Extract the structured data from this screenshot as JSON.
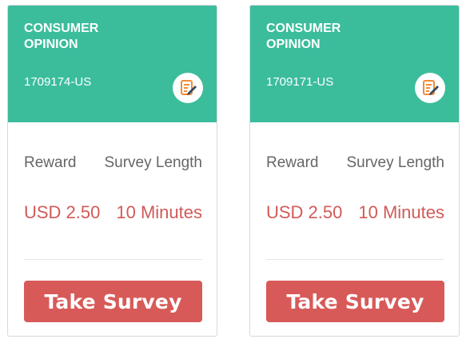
{
  "cards": [
    {
      "title": "CONSUMER\nOPINION",
      "survey_id": "1709174-US",
      "labels": {
        "reward": "Reward",
        "length": "Survey Length"
      },
      "values": {
        "reward": "USD 2.50",
        "length": "10 Minutes"
      },
      "button_label": "Take Survey"
    },
    {
      "title": "CONSUMER\nOPINION",
      "survey_id": "1709171-US",
      "labels": {
        "reward": "Reward",
        "length": "Survey Length"
      },
      "values": {
        "reward": "USD 2.50",
        "length": "10 Minutes"
      },
      "button_label": "Take Survey"
    }
  ],
  "icons": {
    "badge": "survey-edit-icon"
  },
  "colors": {
    "header": "#3bbd9c",
    "value_text": "#d15a58",
    "button": "#d75a59",
    "icon_accent": "#f28c38"
  }
}
